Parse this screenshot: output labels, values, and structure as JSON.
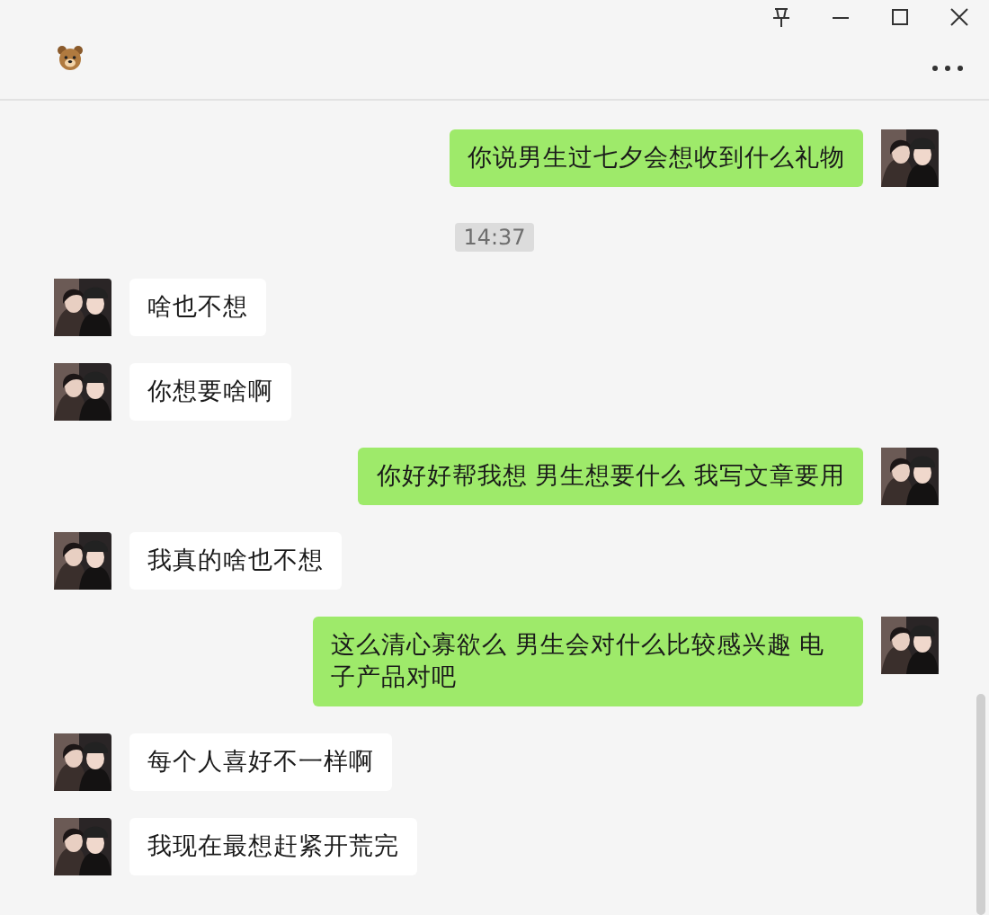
{
  "messages": [
    {
      "kind": "sent",
      "text": "你说男生过七夕会想收到什么礼物"
    },
    {
      "kind": "time",
      "text": "14:37"
    },
    {
      "kind": "received",
      "text": "啥也不想"
    },
    {
      "kind": "received",
      "text": "你想要啥啊"
    },
    {
      "kind": "sent",
      "text": "你好好帮我想 男生想要什么 我写文章要用"
    },
    {
      "kind": "received",
      "text": "我真的啥也不想"
    },
    {
      "kind": "sent",
      "text": "这么清心寡欲么 男生会对什么比较感兴趣 电子产品对吧"
    },
    {
      "kind": "received",
      "text": "每个人喜好不一样啊"
    },
    {
      "kind": "received",
      "text": "我现在最想赶紧开荒完"
    }
  ]
}
